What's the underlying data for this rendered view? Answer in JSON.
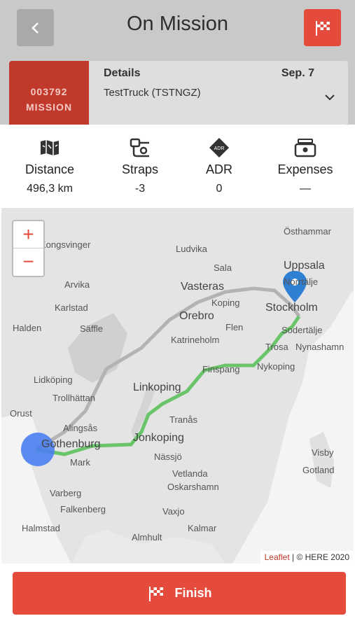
{
  "header": {
    "title": "On Mission",
    "back_icon": "chevron-left-icon",
    "flag_icon": "checkered-flag-icon"
  },
  "mission_card": {
    "mission_id": "003792",
    "mission_label": "MISSION",
    "details_label": "Details",
    "truck": "TestTruck (TSTNGZ)",
    "date": "Sep. 7",
    "expand_icon": "chevron-down-icon"
  },
  "stats": [
    {
      "label": "Distance",
      "value": "496,3 km",
      "icon": "map-icon"
    },
    {
      "label": "Straps",
      "value": "-3",
      "icon": "strap-icon"
    },
    {
      "label": "ADR",
      "value": "0",
      "icon": "adr-diamond-icon"
    },
    {
      "label": "Expenses",
      "value": "—",
      "icon": "cash-register-icon"
    }
  ],
  "map": {
    "zoom_in": "+",
    "zoom_out": "−",
    "attribution_link": "Leaflet",
    "attribution_text": "| © HERE 2020",
    "places": {
      "osthammar": "Östhammar",
      "kongsvinger": "Kongsvinger",
      "ludvika": "Ludvika",
      "uppsala": "Uppsala",
      "sala": "Sala",
      "arvika": "Arvika",
      "vasteras": "Vasteras",
      "norrtalje": "Norrtälje",
      "karlstad": "Karlstad",
      "koping": "Koping",
      "stockholm": "Stockholm",
      "halden": "Halden",
      "saffle": "Säffle",
      "orebro": "Orebro",
      "flen": "Flen",
      "sodertalje": "Sodertälje",
      "katrineholm": "Katrineholm",
      "trosa": "Trosa",
      "nynashamn": "Nynashamn",
      "finspang": "Finspang",
      "nykoping": "Nykoping",
      "lidkoping": "Lidköping",
      "linkoping": "Linkoping",
      "trollhattan": "Trollhättan",
      "orust": "Orust",
      "tranas": "Tranås",
      "alingsas": "Alingsås",
      "gothenburg": "Gothenburg",
      "jonkoping": "Jonkoping",
      "visby": "Visby",
      "mark": "Mark",
      "nassjo": "Nässjö",
      "gotland": "Gotland",
      "vetlanda": "Vetlanda",
      "varberg": "Varberg",
      "oskarshamn": "Oskarshamn",
      "falkenberg": "Falkenberg",
      "vaxjo": "Vaxjo",
      "halmstad": "Halmstad",
      "kalmar": "Kalmar",
      "almhult": "Almhult"
    },
    "colors": {
      "route": "#6ac46a",
      "alt_route": "#b3b3b3",
      "marker": "#2f7fd3",
      "origin": "#4a7ff0"
    }
  },
  "finish": {
    "label": "Finish",
    "icon": "checkered-flag-icon"
  }
}
